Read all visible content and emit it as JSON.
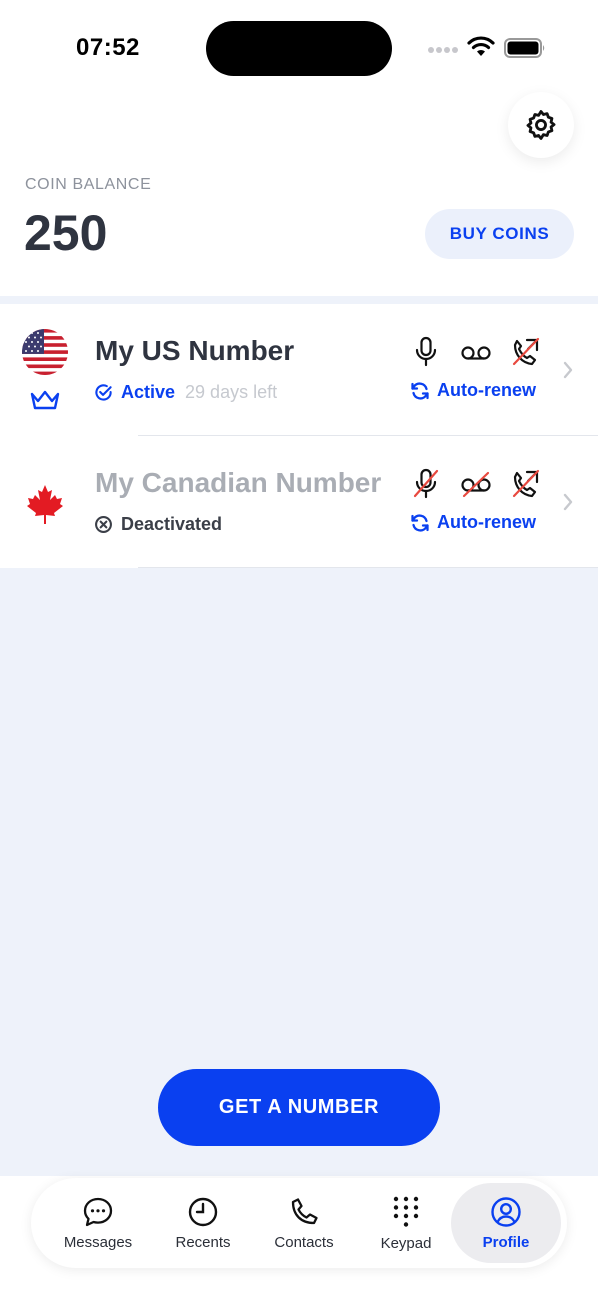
{
  "status_bar": {
    "time": "07:52"
  },
  "header": {
    "coin_label": "COIN BALANCE",
    "coin_value": "250",
    "buy_label": "BUY COINS",
    "settings_icon": "gear-icon"
  },
  "numbers": [
    {
      "name": "My US Number",
      "flag": "us-flag",
      "status": "Active",
      "days_left": "29 days left",
      "features": {
        "voice": "enabled",
        "voicemail": "enabled",
        "call_forwarding": "disabled"
      },
      "auto_renew": "Auto-renew",
      "premium": true
    },
    {
      "name": "My Canadian Number",
      "flag": "canada-flag",
      "status": "Deactivated",
      "features": {
        "voice": "disabled",
        "voicemail": "disabled",
        "call_forwarding": "disabled"
      },
      "auto_renew": "Auto-renew",
      "premium": false
    }
  ],
  "cta": {
    "label": "GET A NUMBER"
  },
  "tabs": [
    {
      "label": "Messages",
      "icon": "chat-bubble-icon",
      "active": false
    },
    {
      "label": "Recents",
      "icon": "clock-icon",
      "active": false
    },
    {
      "label": "Contacts",
      "icon": "phone-icon",
      "active": false
    },
    {
      "label": "Keypad",
      "icon": "keypad-icon",
      "active": false
    },
    {
      "label": "Profile",
      "icon": "profile-icon",
      "active": true
    }
  ],
  "colors": {
    "accent": "#0a40f0",
    "background": "#eef2fa",
    "disabled_slash": "#e8493f"
  }
}
